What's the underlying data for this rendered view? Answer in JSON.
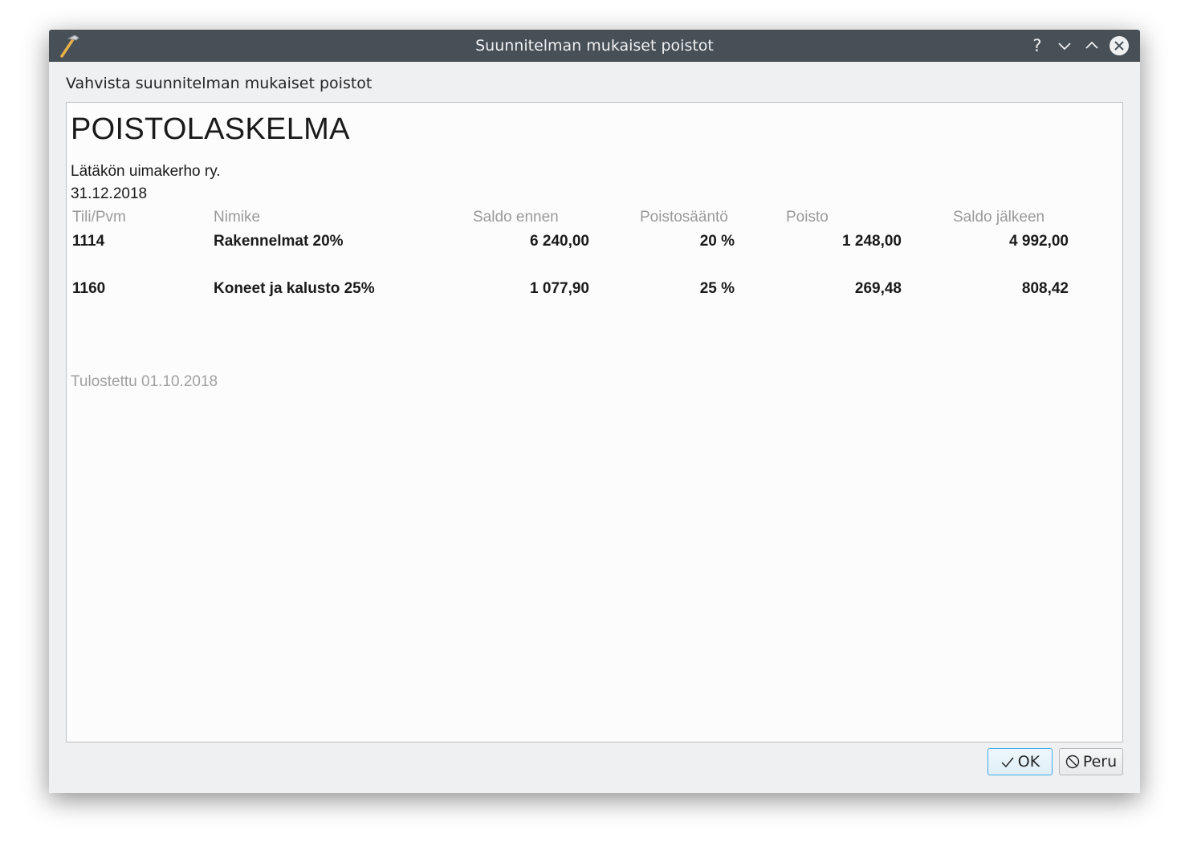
{
  "window": {
    "title": "Suunnitelman mukaiset poistot",
    "help_symbol": "?",
    "icons": [
      "hammer-icon",
      "help-icon",
      "minimize-icon",
      "maximize-icon",
      "close-icon"
    ]
  },
  "prompt": "Vahvista suunnitelman mukaiset poistot",
  "report": {
    "title": "POISTOLASKELMA",
    "organization": "Lätäkön uimakerho ry.",
    "date": "31.12.2018",
    "columns": [
      "Tili/Pvm",
      "Nimike",
      "Saldo ennen",
      "Poistosääntö",
      "Poisto",
      "Saldo jälkeen"
    ],
    "rows": [
      [
        "1114",
        "Rakennelmat 20%",
        "6 240,00",
        "20 %",
        "1 248,00",
        "4 992,00"
      ],
      [
        "1160",
        "Koneet ja kalusto 25%",
        "1 077,90",
        "25 %",
        "269,48",
        "808,42"
      ]
    ],
    "printed": "Tulostettu 01.10.2018"
  },
  "buttons": {
    "ok": "OK",
    "cancel": "Peru"
  },
  "colors": {
    "titlebar": "#475057",
    "accent": "#3daee9",
    "header_text": "#9a9a9a"
  }
}
